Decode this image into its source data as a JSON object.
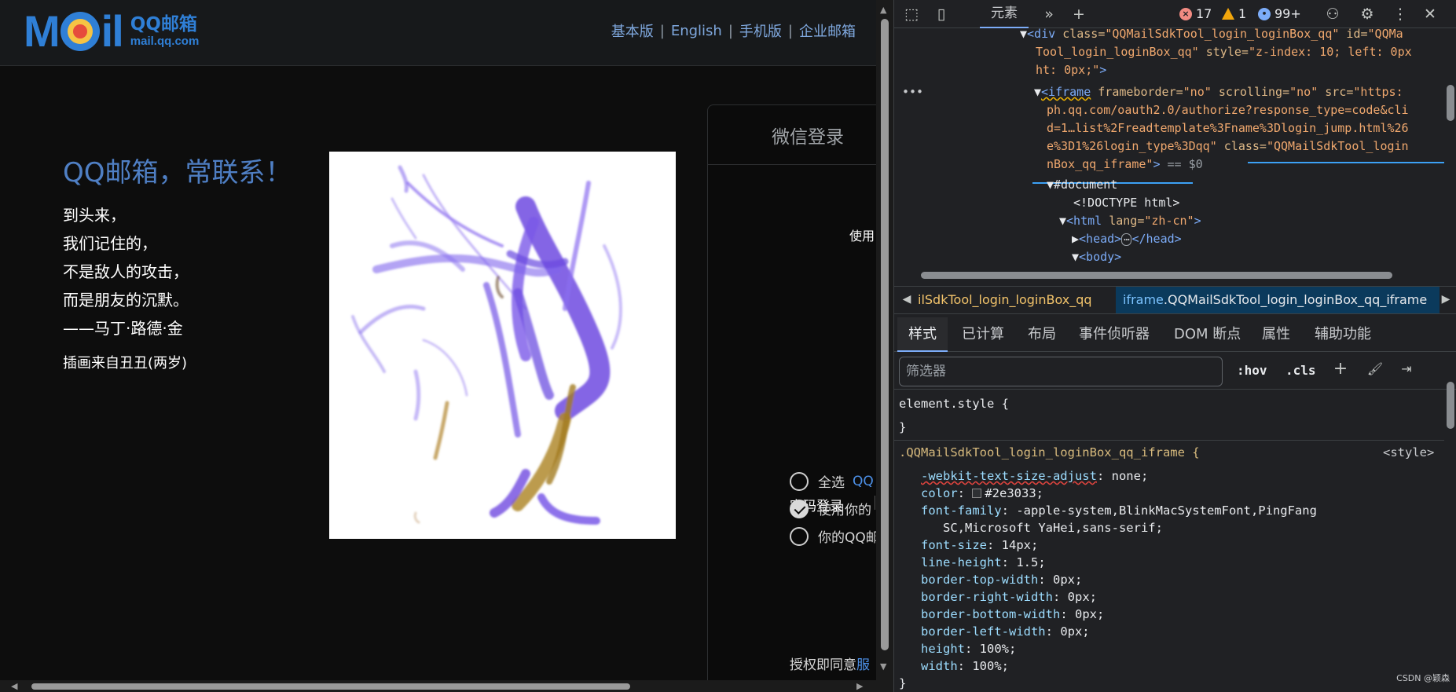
{
  "page": {
    "logo": {
      "mark_m": "M",
      "mark_il": "il",
      "name_cn": "QQ邮箱",
      "url": "mail.qq.com"
    },
    "top_links": [
      "基本版",
      "English",
      "手机版",
      "企业邮箱"
    ],
    "top_link_separator": "|",
    "slogan": "QQ邮箱，常联系！",
    "poem": [
      "到头来，",
      "我们记住的，",
      "不是敌人的攻击，",
      "而是朋友的沉默。",
      "——马丁·路德·金"
    ],
    "illustration_credit": "插画来自丑丑(两岁)",
    "login": {
      "title": "微信登录",
      "use_text": "使用",
      "password_login": "密码登录",
      "options": [
        {
          "label": "全选",
          "link": "QQ",
          "checked": false
        },
        {
          "label": "使用你的",
          "link": "",
          "checked": true
        },
        {
          "label": "你的QQ邮",
          "link": "",
          "checked": false
        }
      ],
      "consent_prefix": "授权即同意",
      "consent_link": "服"
    }
  },
  "devtools": {
    "tabs": {
      "elements": "元素"
    },
    "errors": "17",
    "warnings": "1",
    "issues": "99+",
    "dom_lines": {
      "l1_tag": "<div",
      "l1_attr": "class=",
      "l1_val": "\"QQMailSdkTool_login_loginBox_qq\"",
      "l1_attr2": "id=",
      "l1_val2": "\"QQMa",
      "l2": "Tool_login_loginBox_qq\"",
      "l2_attr": "style=",
      "l2_val": "\"z-index: 10; left: 0px",
      "l3": "ht: 0px;\"",
      "l3_end": ">",
      "l4_tag": "<iframe",
      "l4_a1": "frameborder=",
      "l4_v1": "\"no\"",
      "l4_a2": "scrolling=",
      "l4_v2": "\"no\"",
      "l4_a3": "src=",
      "l4_v3": "\"https:",
      "l5": "ph.qq.com/oauth2.0/authorize?response_type=code&cli",
      "l6": "d=1…list%2Freadtemplate%3Fname%3Dlogin_jump.html%26",
      "l7": "e%3D1%26login_type%3Dqq\"",
      "l7_attr": "class=",
      "l7_val": "\"QQMailSdkTool_login",
      "l8": "nBox_qq_iframe\"",
      "l8_end": ">",
      "l8_eq": "== $0",
      "l9": "#document",
      "l10": "<!DOCTYPE html>",
      "l11_tag": "<html",
      "l11_attr": "lang=",
      "l11_val": "\"zh-cn\"",
      "l11_end": ">",
      "l12": "<head>",
      "l12_dots": "⋯",
      "l12_close": "</head>",
      "l13": "<body>",
      "ellipsis": "•••"
    },
    "breadcrumbs": {
      "first": "ilSdkTool_login_loginBox_qq",
      "second_tag": "iframe",
      "second_class": ".QQMailSdkTool_login_loginBox_qq_iframe"
    },
    "sub_tabs": [
      "样式",
      "已计算",
      "布局",
      "事件侦听器",
      "DOM 断点",
      "属性",
      "辅助功能"
    ],
    "filter_placeholder": "筛选器",
    "hov": ":hov",
    "cls": ".cls",
    "styles": {
      "element_style": "element.style {",
      "close": "}",
      "selector": ".QQMailSdkTool_login_loginBox_qq_iframe {",
      "source": "<style>",
      "declarations": [
        [
          "-webkit-text-size-adjust",
          "none;"
        ],
        [
          "color",
          "#2e3033;"
        ],
        [
          "font-family",
          "-apple-system,BlinkMacSystemFont,PingFang"
        ],
        [
          "",
          "SC,Microsoft YaHei,sans-serif;"
        ],
        [
          "font-size",
          "14px;"
        ],
        [
          "line-height",
          "1.5;"
        ],
        [
          "border-top-width",
          "0px;"
        ],
        [
          "border-right-width",
          "0px;"
        ],
        [
          "border-bottom-width",
          "0px;"
        ],
        [
          "border-left-width",
          "0px;"
        ],
        [
          "height",
          "100%;"
        ],
        [
          "width",
          "100%;"
        ]
      ]
    },
    "watermark": "CSDN @颖森"
  },
  "colors": {
    "accent_blue": "#2f7fd6",
    "link_blue": "#7fa8de",
    "selection_underline": "#3ca1f5",
    "painting_purple": "#6f4be0",
    "painting_ochre": "#b08a2e"
  }
}
